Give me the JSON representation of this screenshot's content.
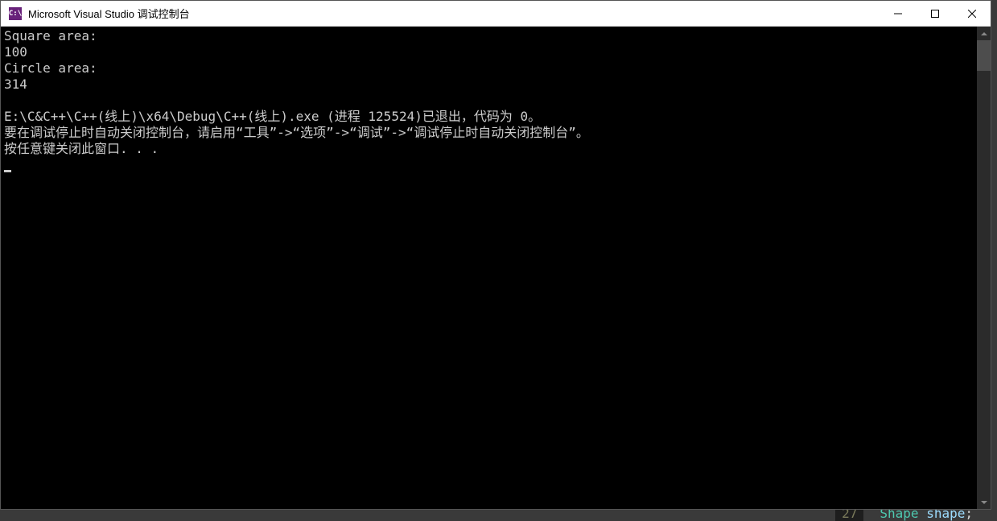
{
  "window": {
    "icon_text": "C:\\",
    "title": "Microsoft Visual Studio 调试控制台"
  },
  "console": {
    "lines": [
      "Square area:",
      "100",
      "Circle area:",
      "314",
      "",
      "E:\\C&C++\\C++(线上)\\x64\\Debug\\C++(线上).exe (进程 125524)已退出，代码为 0。",
      "要在调试停止时自动关闭控制台，请启用“工具”->“选项”->“调试”->“调试停止时自动关闭控制台”。",
      "按任意键关闭此窗口. . ."
    ]
  },
  "background": {
    "line_number": "27",
    "code_type": "Shape",
    "code_var": "shape",
    "code_punc": ";"
  }
}
